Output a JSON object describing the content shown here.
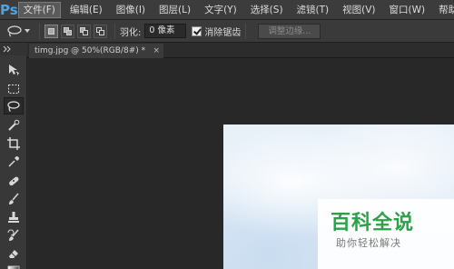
{
  "app": {
    "logo_text": "Ps"
  },
  "menu": [
    {
      "label": "文件(F)",
      "active": true
    },
    {
      "label": "编辑(E)"
    },
    {
      "label": "图像(I)"
    },
    {
      "label": "图层(L)"
    },
    {
      "label": "文字(Y)"
    },
    {
      "label": "选择(S)"
    },
    {
      "label": "滤镜(T)"
    },
    {
      "label": "视图(V)"
    },
    {
      "label": "窗口(W)"
    },
    {
      "label": "帮助(H)"
    }
  ],
  "options": {
    "feather_label": "羽化:",
    "feather_value": "0 像素",
    "antialias_label": "消除锯齿",
    "antialias_checked": true,
    "refine_edge_label": "调整边缘..."
  },
  "document": {
    "tab_title": "timg.jpg @ 50%(RGB/8#) *",
    "close_glyph": "×"
  },
  "tools": [
    {
      "icon": "move-icon"
    },
    {
      "icon": "marquee-icon"
    },
    {
      "icon": "lasso-icon",
      "active": true
    },
    {
      "icon": "quick-selection-icon"
    },
    {
      "icon": "crop-icon"
    },
    {
      "icon": "eyedropper-icon"
    },
    {
      "icon": "spot-healing-icon"
    },
    {
      "icon": "brush-icon"
    },
    {
      "icon": "clone-stamp-icon"
    },
    {
      "icon": "history-brush-icon"
    },
    {
      "icon": "eraser-icon"
    },
    {
      "icon": "gradient-icon"
    }
  ],
  "watermark": {
    "title": "百科全说",
    "subtitle": "助你轻松解决",
    "title_color": "#2ba245"
  },
  "colors": {
    "ps_blue": "#4fa3e0",
    "ui_dark": "#2b2b2b"
  }
}
